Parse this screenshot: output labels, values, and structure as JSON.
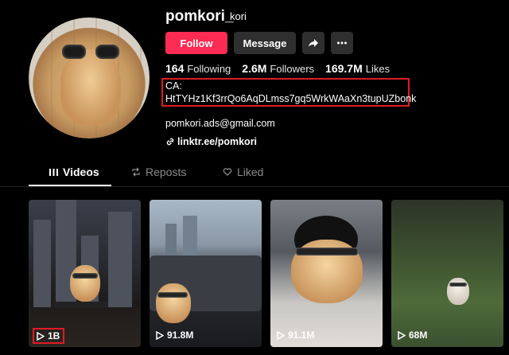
{
  "profile": {
    "username": "pomkori_",
    "nickname": "kori"
  },
  "actions": {
    "follow": "Follow",
    "message": "Message"
  },
  "stats": {
    "following_count": "164",
    "following_label": "Following",
    "followers_count": "2.6M",
    "followers_label": "Followers",
    "likes_count": "169.7M",
    "likes_label": "Likes"
  },
  "bio": {
    "line1": "CA:",
    "line2": "HtTYHz1Kf3rrQo6AqDLmss7gq5WrkWAaXn3tupUZbonk",
    "email": "pomkori.ads@gmail.com",
    "link": "linktr.ee/pomkori"
  },
  "tabs": [
    {
      "label": "Videos",
      "active": true
    },
    {
      "label": "Reposts",
      "active": false
    },
    {
      "label": "Liked",
      "active": false
    }
  ],
  "videos": [
    {
      "views": "1B",
      "highlighted": true
    },
    {
      "views": "91.8M",
      "highlighted": false
    },
    {
      "views": "91.1M",
      "highlighted": false
    },
    {
      "views": "68M",
      "highlighted": false
    }
  ],
  "colors": {
    "accent": "#fe2c55",
    "highlight": "#e01b24",
    "button_bg": "#2f2f2f",
    "muted_tab": "#8a8a8a"
  },
  "icons": [
    "share-icon",
    "more-icon",
    "link-icon",
    "grid-icon",
    "repost-icon",
    "liked-icon",
    "play-icon"
  ]
}
